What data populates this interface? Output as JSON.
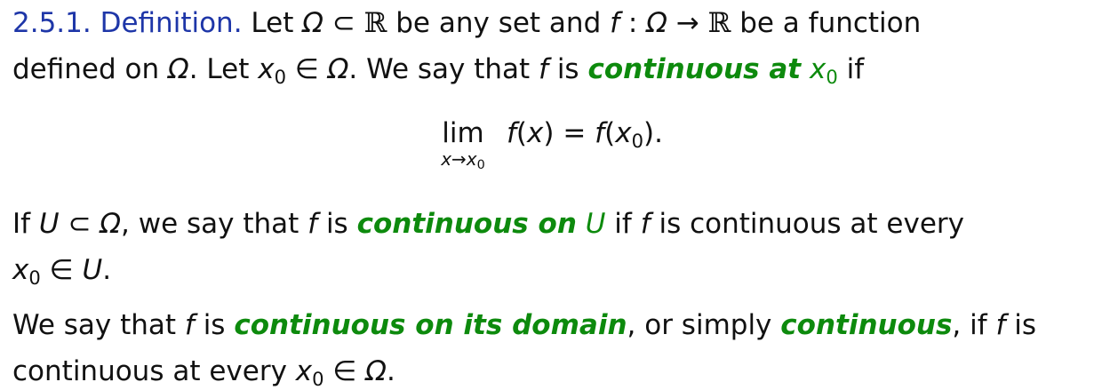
{
  "definition": {
    "heading": "2.5.1. Definition.",
    "line1": {
      "t1": " Let ",
      "Omega": "Ω",
      "t2": " ⊂ ",
      "R": "ℝ",
      "t3": " be any set and ",
      "f": "f",
      "t4": " : ",
      "Omega2": "Ω",
      "t5": " → ",
      "R2": "ℝ",
      "t6": " be a function"
    },
    "line2": {
      "t1": "defined on ",
      "Omega": "Ω",
      "t2": ". Let ",
      "x": "x",
      "sub0": "0",
      "t3": " ∈ ",
      "Omega2": "Ω",
      "t4": ". We say that ",
      "f": "f",
      "t5": " is ",
      "term": "continuous at",
      "x2": "x",
      "sub02": "0",
      "t6": " if"
    },
    "equation": {
      "lim": "lim",
      "under_x": "x",
      "under_arrow": "→",
      "under_x0": "x",
      "under_sub": "0",
      "f1": "f",
      "paren1": "(",
      "x": "x",
      "eq": ") = ",
      "f2": "f",
      "paren2": "(",
      "x0": "x",
      "sub0": "0",
      "close": ")."
    }
  },
  "paragraph2": {
    "t1": "If ",
    "U": "U",
    "t2": " ⊂ ",
    "Omega": "Ω",
    "t3": ", we say that ",
    "f": "f",
    "t4": " is ",
    "term": "continuous on",
    "U2": "U",
    "t5": " if ",
    "f2": "f",
    "t6": " is continuous at every",
    "x": "x",
    "sub0": "0",
    "t7": " ∈ ",
    "U3": "U",
    "t8": "."
  },
  "paragraph3": {
    "t1": "We say that ",
    "f": "f",
    "t2": " is ",
    "term1": "continuous on its domain",
    "t3": ", or simply ",
    "term2": "continuous",
    "t4": ", if ",
    "f2": "f",
    "t5": " is",
    "t6": "continuous at every ",
    "x": "x",
    "sub0": "0",
    "t7": " ∈ ",
    "Omega": "Ω",
    "t8": "."
  }
}
